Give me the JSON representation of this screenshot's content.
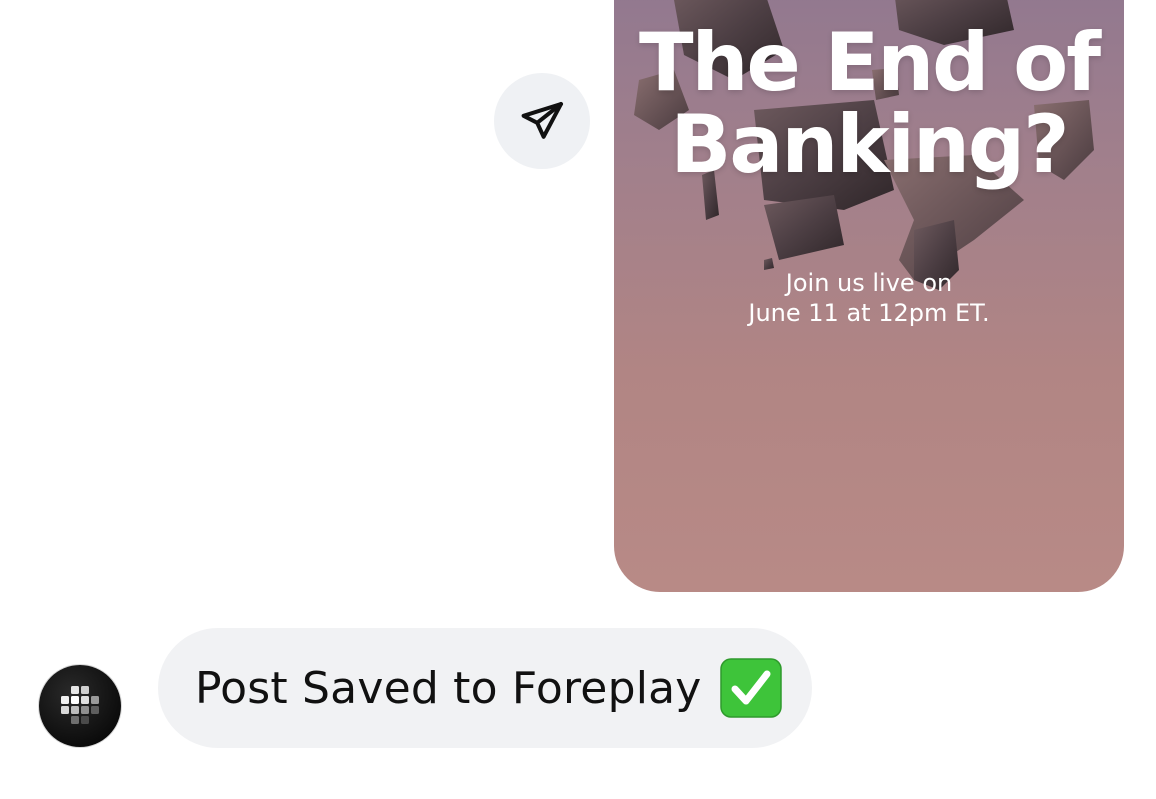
{
  "post": {
    "title_line1": "The End of",
    "title_line2": "Banking?",
    "subtitle_line1": "Join us live on",
    "subtitle_line2": "June 11 at 12pm ET."
  },
  "message": {
    "text": "Post Saved to Foreplay"
  },
  "icons": {
    "share": "send-paper-plane-icon",
    "status": "white-check-mark-icon",
    "avatar": "foreplay-logo-icon"
  },
  "colors": {
    "bubble": "#f1f2f4",
    "check_green": "#3ec43a",
    "card_top": "#8f7790",
    "card_bottom": "#b88a86"
  }
}
